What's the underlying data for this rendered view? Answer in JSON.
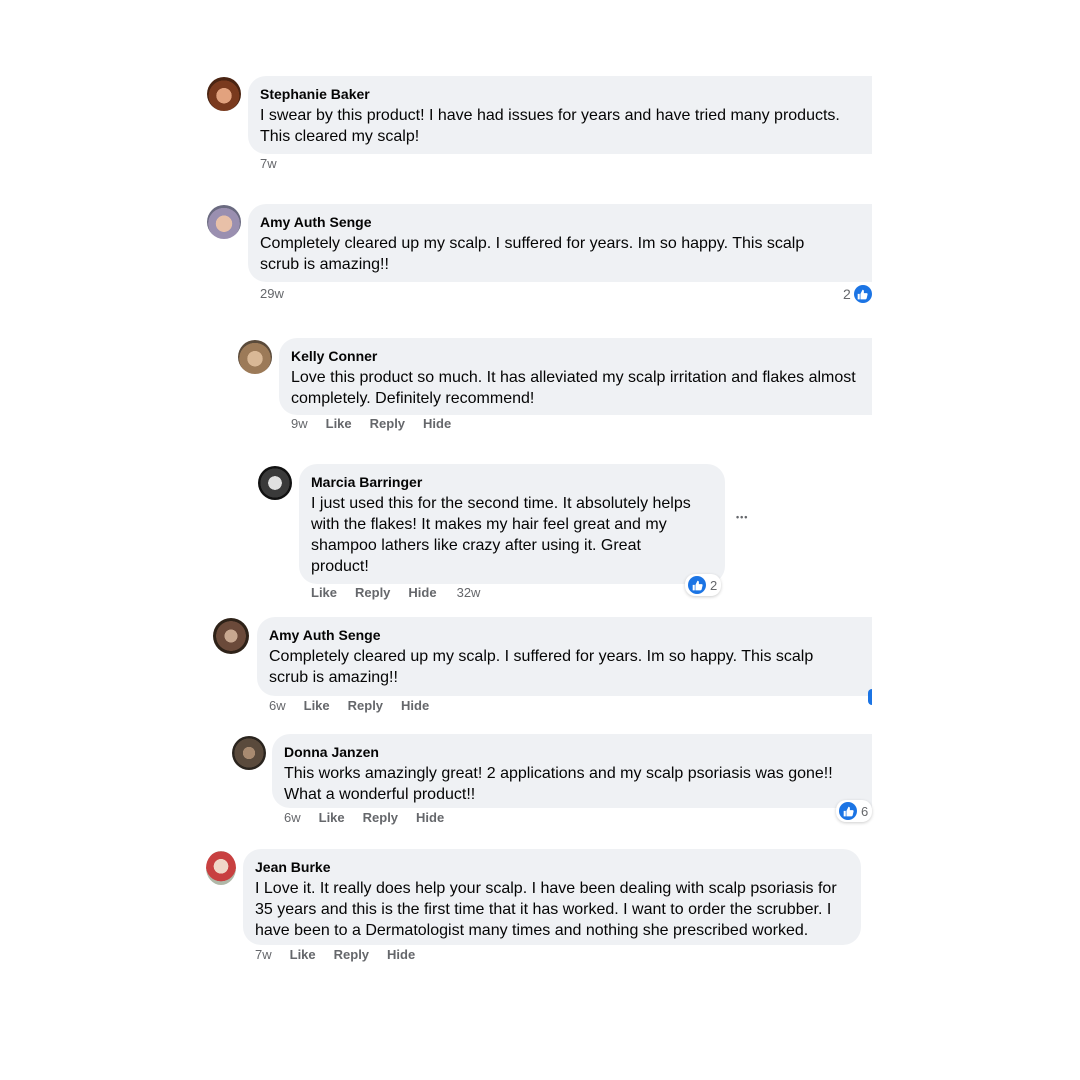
{
  "colors": {
    "bubble_bg": "#eff1f4",
    "meta_text": "#65676b",
    "like_blue": "#1b74e4"
  },
  "comments": [
    {
      "author": "Stephanie Baker",
      "lines": [
        "I swear by this product! I have had issues for years and have tried many products.",
        "This cleared my scalp!"
      ],
      "time": "7w"
    },
    {
      "author": "Amy Auth Senge",
      "lines": [
        "Completely cleared up my scalp. I suffered for years. Im so happy. This scalp",
        "scrub is amazing!!"
      ],
      "time": "29w",
      "reactions": "2"
    },
    {
      "author": "Kelly Conner",
      "lines": [
        "Love this product so much. It has alleviated my scalp irritation and flakes almost",
        "completely. Definitely recommend!"
      ],
      "time": "9w",
      "actions": [
        "Like",
        "Reply",
        "Hide"
      ]
    },
    {
      "author": "Marcia Barringer",
      "lines": [
        "I just used this for the second time. It absolutely helps",
        "with the flakes! It makes my hair feel great and my",
        "shampoo lathers like crazy after using it. Great",
        "product!"
      ],
      "time": "32w",
      "actions": [
        "Like",
        "Reply",
        "Hide"
      ],
      "reactions": "2",
      "more": "•••"
    },
    {
      "author": "Amy Auth Senge",
      "lines": [
        "Completely cleared up my scalp. I suffered for years. Im so happy. This scalp",
        "scrub is amazing!!"
      ],
      "time": "6w",
      "actions": [
        "Like",
        "Reply",
        "Hide"
      ]
    },
    {
      "author": "Donna Janzen",
      "lines": [
        "This works amazingly great! 2 applications and my scalp psoriasis was gone!!",
        "What a wonderful product!!"
      ],
      "time": "6w",
      "actions": [
        "Like",
        "Reply",
        "Hide"
      ],
      "reactions": "6"
    },
    {
      "author": "Jean Burke",
      "lines": [
        "I Love it. It really does help your scalp. I have been dealing with scalp psoriasis for",
        "35 years and this is the first time that it has worked. I want to order the scrubber. I",
        "have been to a Dermatologist many times and nothing she prescribed worked."
      ],
      "time": "7w",
      "actions": [
        "Like",
        "Reply",
        "Hide"
      ]
    }
  ]
}
